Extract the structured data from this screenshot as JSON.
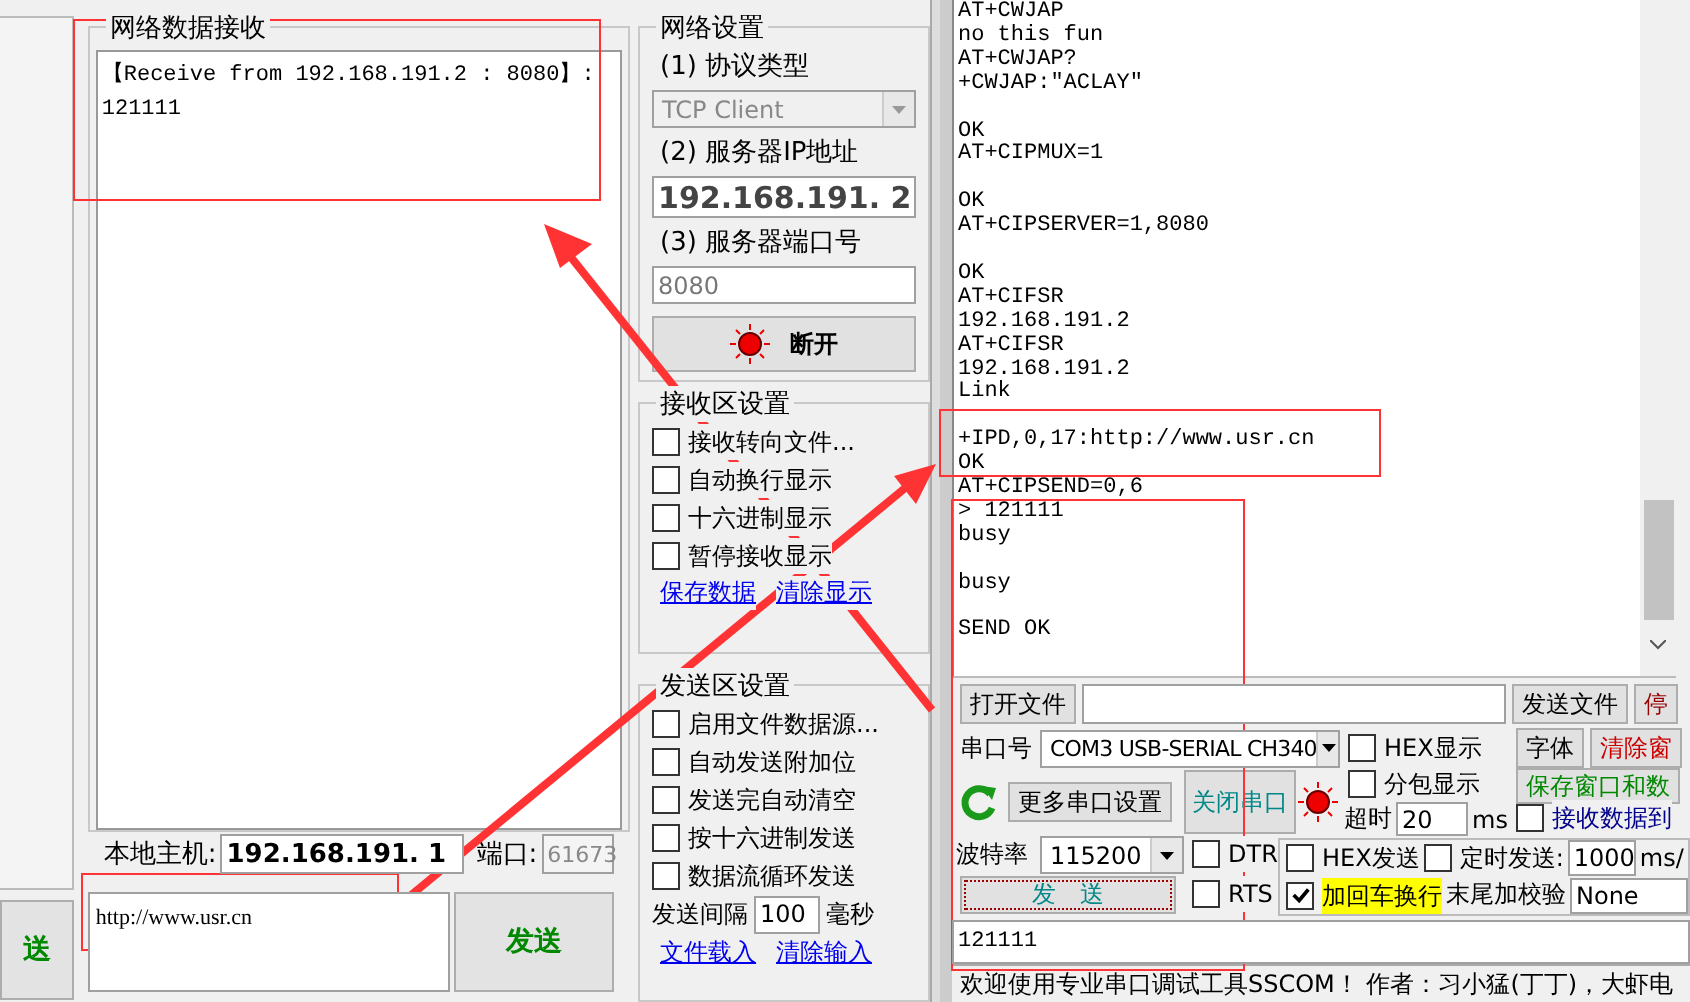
{
  "left_window": {
    "side_button": "送",
    "receive": {
      "title": "网络数据接收",
      "text": "【Receive from 192.168.191.2 : 8080】:\n121111"
    },
    "local_host": {
      "label": "本地主机:",
      "value": "192.168.191. 1",
      "port_label": "端口:",
      "port": "61673",
      "port_disabled": true
    },
    "send_text": "http://www.usr.cn",
    "send_button": "发送",
    "network": {
      "title": "网络设置",
      "protocol_label": "(1) 协议类型",
      "protocol": "TCP Client",
      "protocol_disabled": true,
      "ip_label": "(2) 服务器IP地址",
      "ip": "192.168.191. 2",
      "port_label": "(3) 服务器端口号",
      "port": "8080",
      "connect_button": "断开"
    },
    "receive_settings": {
      "title": "接收区设置",
      "options": [
        {
          "label": "接收转向文件...",
          "checked": false
        },
        {
          "label": "自动换行显示",
          "checked": false
        },
        {
          "label": "十六进制显示",
          "checked": false
        },
        {
          "label": "暂停接收显示",
          "checked": false
        }
      ],
      "links": [
        "保存数据",
        "清除显示"
      ]
    },
    "send_settings": {
      "title": "发送区设置",
      "options": [
        {
          "label": "启用文件数据源...",
          "checked": false
        },
        {
          "label": "自动发送附加位",
          "checked": false
        },
        {
          "label": "发送完自动清空",
          "checked": false
        },
        {
          "label": "按十六进制发送",
          "checked": false
        },
        {
          "label": "数据流循环发送",
          "checked": false
        }
      ],
      "interval_label": "发送间隔",
      "interval": "100",
      "interval_unit": "毫秒",
      "links": [
        "文件载入",
        "清除输入"
      ]
    }
  },
  "right_window": {
    "terminal": "AT+CWJAP\nno this fun\nAT+CWJAP?\n+CWJAP:\"ACLAY\"\n\nOK\nAT+CIPMUX=1\n\nOK\nAT+CIPSERVER=1,8080\n\nOK\nAT+CIFSR\n192.168.191.2\nAT+CIFSR\n192.168.191.2\nLink\n\n+IPD,0,17:http://www.usr.cn\nOK\nAT+CIPSEND=0,6\n> 121111\nbusy\n\nbusy\n\nSEND OK",
    "file_button": "打开文件",
    "send_file_button": "发送文件",
    "stop_button": "停",
    "port_label": "串口号",
    "port": "COM3 USB-SERIAL CH340",
    "more_button": "更多串口设置",
    "close_button": "关闭串口",
    "baud_label": "波特率",
    "baud": "115200",
    "send_button": "发　送",
    "line_checks": [
      {
        "label": "DTR",
        "checked": false
      },
      {
        "label": "RTS",
        "checked": false
      }
    ],
    "display_checks": [
      {
        "label": "HEX显示",
        "checked": false
      },
      {
        "label": "分包显示",
        "checked": false
      }
    ],
    "timeout_label": "超时",
    "timeout": "20",
    "timeout_unit": "ms",
    "font_button": "字体",
    "clear_button": "清除窗",
    "save_button": "保存窗口和数",
    "save_to_file": {
      "label": "接收数据到",
      "checked": false
    },
    "hex_send": {
      "label": "HEX发送",
      "checked": false
    },
    "timed_send": {
      "label": "定时发送:",
      "checked": false
    },
    "interval": "1000",
    "interval_unit": "ms/",
    "add_newline": {
      "label": "加回车换行",
      "checked": true
    },
    "checksum_label": "末尾加校验",
    "checksum": "None",
    "input": "121111",
    "status": "欢迎使用专业串口调试工具SSCOM！  作者：习小猛(丁丁)，大虾电"
  }
}
